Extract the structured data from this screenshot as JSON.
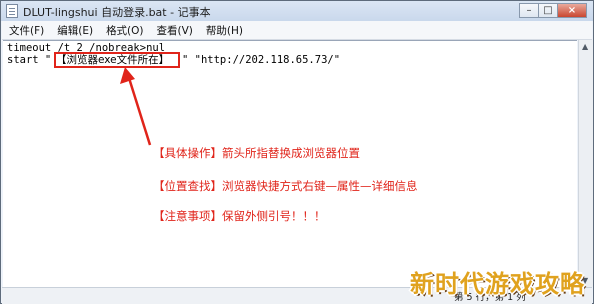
{
  "window": {
    "title": "DLUT-lingshui 自动登录.bat - 记事本",
    "buttons": {
      "minimize": "–",
      "maximize": "□",
      "close": "×"
    }
  },
  "menu": [
    "文件(F)",
    "编辑(E)",
    "格式(O)",
    "查看(V)",
    "帮助(H)"
  ],
  "editor": {
    "line1": "timeout /t 2 /nobreak>nul",
    "line2_prefix": "start \"",
    "highlight_text": "【浏览器exe文件所在】",
    "line2_suffix": "\" \"http://202.118.65.73/\"",
    "highlight_color": "#e0241a"
  },
  "notes": [
    "【具体操作】箭头所指替换成浏览器位置",
    "【位置查找】浏览器快捷方式右键—属性—详细信息",
    "【注意事项】保留外侧引号！！！"
  ],
  "statusbar": {
    "position": "第 5 行，第 1 列"
  },
  "watermark": "新时代游戏攻略"
}
